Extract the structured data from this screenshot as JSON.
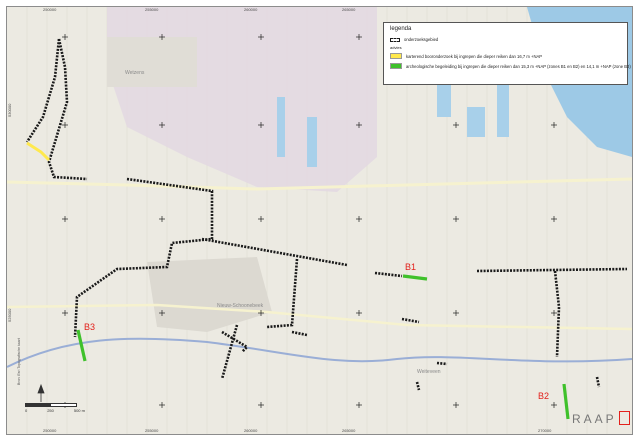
{
  "map": {
    "places": {
      "wetzens": "Wetzens",
      "nieuw_schoonebeek": "Nieuw-Schoonebeek",
      "weiteveen": "Weiteveen"
    },
    "zone_labels": {
      "b1": "B1",
      "b2": "B2",
      "b3": "B3"
    },
    "grid_labels_top": [
      "250000",
      "255000",
      "260000",
      "265000"
    ],
    "grid_labels_bottom": [
      "250000",
      "255000",
      "260000",
      "265000",
      "270000"
    ],
    "grid_labels_left": [
      "530000",
      "525000"
    ],
    "credits": "Bron: Esri Topografische kaart",
    "colors": {
      "water": "#9dc9e6",
      "rural": "#e8e7de",
      "builtup": "#e3d9e6",
      "road": "#f5f1d0",
      "survey_line": "#1a1a1a",
      "yellow_zone": "#ffe94d",
      "green_zone": "#3fc12b",
      "zone_label": "#e3211c"
    }
  },
  "legend": {
    "title": "legenda",
    "items": [
      {
        "label": "onderzoeksgebied",
        "swatch": "dashed-outline"
      },
      {
        "label": "karterend booronderzoek bij ingrepen die dieper reiken dan 16,7 m +NAP",
        "swatch": "yellow"
      },
      {
        "label": "archeologische begeleiding bij ingrepen die dieper reiken dan 15,3 m +NAP (zones B1 en B2) en 14,1 m +NAP (zone B3)",
        "swatch": "green"
      }
    ],
    "group_label": "advies"
  },
  "scale": {
    "left": "0",
    "mid": "250",
    "right": "500 m"
  },
  "brand": {
    "name": "RAAP"
  }
}
